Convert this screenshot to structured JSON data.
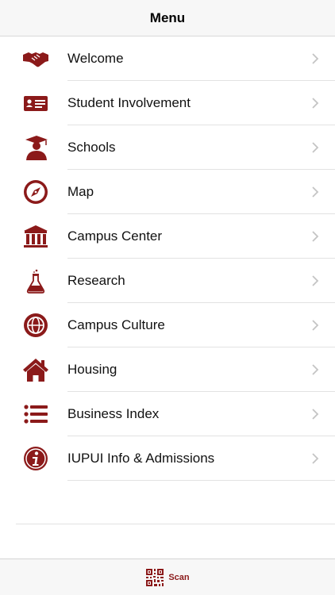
{
  "header": {
    "title": "Menu"
  },
  "accent": "#8b1a1a",
  "menu": {
    "items": [
      {
        "label": "Welcome",
        "icon": "handshake-icon"
      },
      {
        "label": "Student Involvement",
        "icon": "id-card-icon"
      },
      {
        "label": "Schools",
        "icon": "graduate-icon"
      },
      {
        "label": "Map",
        "icon": "compass-icon"
      },
      {
        "label": "Campus Center",
        "icon": "building-columns-icon"
      },
      {
        "label": "Research",
        "icon": "flask-icon"
      },
      {
        "label": "Campus Culture",
        "icon": "globe-icon"
      },
      {
        "label": "Housing",
        "icon": "house-icon"
      },
      {
        "label": "Business Index",
        "icon": "list-icon"
      },
      {
        "label": "IUPUI Info & Admissions",
        "icon": "info-icon"
      }
    ]
  },
  "tabbar": {
    "scan_label": "Scan",
    "scan_icon": "qr-code-icon"
  }
}
